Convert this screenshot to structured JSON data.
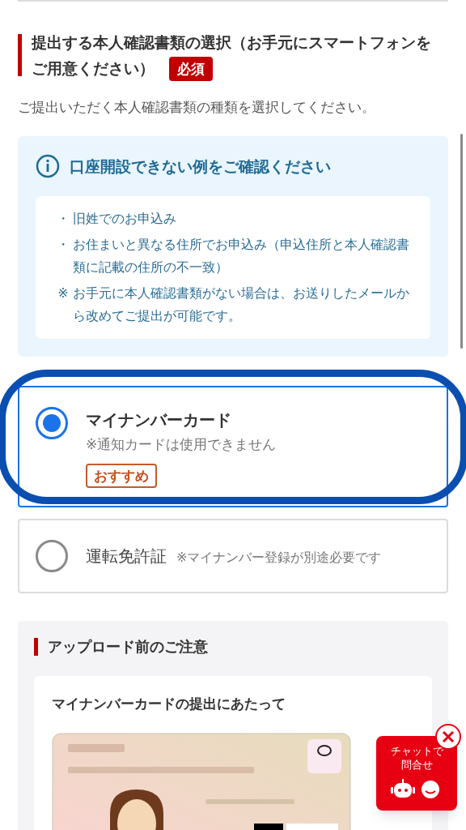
{
  "section_title": "提出する本人確認書類の選択（お手元にスマートフォンをご用意ください）",
  "required_badge": "必須",
  "instruction": "ご提出いただく本人確認書類の種類を選択してください。",
  "notice": {
    "title": "口座開設できない例をご確認ください",
    "items": [
      {
        "mark": "・",
        "text": "旧姓でのお申込み"
      },
      {
        "mark": "・",
        "text": "お住まいと異なる住所でお申込み（申込住所と本人確認書類に記載の住所の不一致）"
      },
      {
        "mark": "※",
        "text": "お手元に本人確認書類がない場合は、お送りしたメールから改めてご提出が可能です。"
      }
    ]
  },
  "options": [
    {
      "kind": "stacked",
      "label": "マイナンバーカード",
      "note": "※通知カードは使用できません",
      "badge": "おすすめ",
      "selected": true,
      "highlighted": true
    },
    {
      "kind": "inline",
      "label": "運転免許証",
      "note": "※マイナンバー登録が別途必要です",
      "selected": false,
      "highlighted": false
    }
  ],
  "precautions": {
    "title": "アップロード前のご注意",
    "card_title": "マイナンバーカードの提出にあたって"
  },
  "chat": {
    "label": "チャットで問合せ"
  }
}
